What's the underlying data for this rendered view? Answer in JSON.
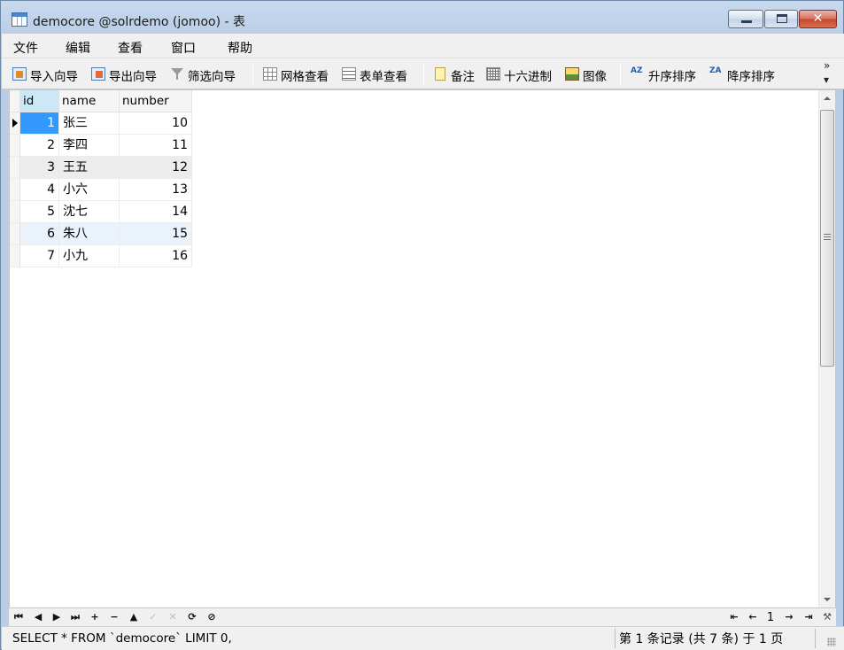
{
  "window": {
    "title": "democore @solrdemo (jomoo) - 表",
    "close_glyph": "✕"
  },
  "menu": [
    "文件",
    "编辑",
    "查看",
    "窗口",
    "帮助"
  ],
  "toolbar": {
    "import_wizard": "导入向导",
    "export_wizard": "导出向导",
    "filter_wizard": "筛选向导",
    "grid_view": "网格查看",
    "form_view": "表单查看",
    "note": "备注",
    "hex": "十六进制",
    "image": "图像",
    "sort_asc": "升序排序",
    "sort_desc": "降序排序",
    "more": "»",
    "more_down": "▾",
    "sort_asc_icon_text": "AZ",
    "sort_desc_icon_text": "ZA"
  },
  "table": {
    "columns": [
      "id",
      "name",
      "number"
    ],
    "rows": [
      {
        "id": "1",
        "name": "张三",
        "number": "10"
      },
      {
        "id": "2",
        "name": "李四",
        "number": "11"
      },
      {
        "id": "3",
        "name": "王五",
        "number": "12"
      },
      {
        "id": "4",
        "name": "小六",
        "number": "13"
      },
      {
        "id": "5",
        "name": "沈七",
        "number": "14"
      },
      {
        "id": "6",
        "name": "朱八",
        "number": "15"
      },
      {
        "id": "7",
        "name": "小九",
        "number": "16"
      }
    ]
  },
  "navigator": {
    "first": "⏮",
    "prev": "◀",
    "next": "▶",
    "last": "⏭",
    "add": "+",
    "delete": "−",
    "apply": "▲",
    "apply_check": "✓",
    "cancel": "✕",
    "refresh": "⟳",
    "stop": "⊘",
    "page_first": "⇤",
    "page_prev": "←",
    "page_value": "1",
    "page_next": "→",
    "page_last": "⇥",
    "settings": "⚒"
  },
  "status": {
    "sql": "SELECT * FROM `democore` LIMIT 0,",
    "count": "第 1 条记录 (共 7 条) 于 1 页"
  }
}
